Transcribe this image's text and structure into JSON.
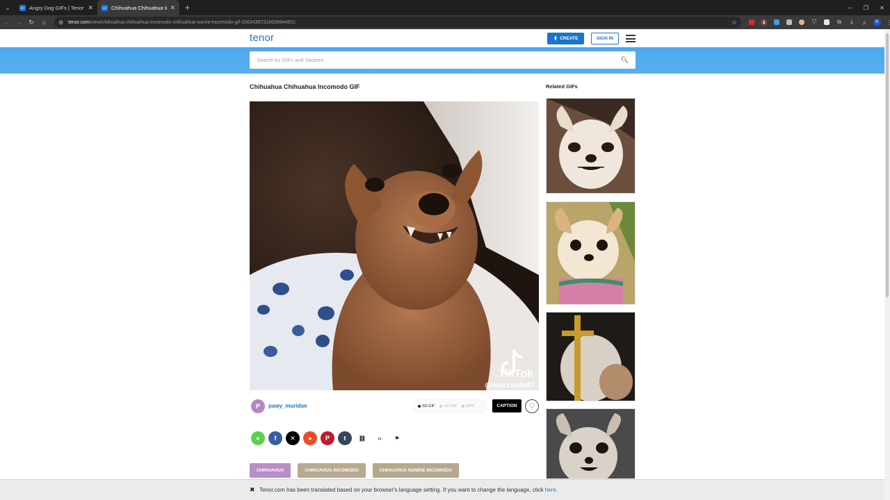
{
  "browser": {
    "tabs": [
      {
        "title": "Angry Dog GIFs | Tenor",
        "active": false
      },
      {
        "title": "Chihuahua Chihuahua Incomo",
        "active": true
      }
    ],
    "new_tab": "+",
    "url_host": "tenor.com",
    "url_path": "/view/chihuahua-chihuahua-incomodo-chihuahua-sonrie-incomodo-gif-15634387316638944501",
    "profile_initial": "N"
  },
  "header": {
    "logo": "tenor",
    "create_label": "CREATE",
    "signin_label": "SIGN IN"
  },
  "search": {
    "placeholder": "Search for GIFs and Stickers"
  },
  "gif": {
    "title": "Chihuahua Chihuahua Incomodo GIF",
    "watermark_brand": "TikTok",
    "watermark_handle": "@marcuslad7",
    "author_initial": "P",
    "author": "pawy_muridae",
    "formats": [
      {
        "label": "SD GIF",
        "selected": true
      },
      {
        "label": "HD GIF",
        "selected": false
      },
      {
        "label": "MP4",
        "selected": false
      }
    ],
    "caption_label": "CAPTION"
  },
  "share": [
    {
      "name": "message",
      "color": "#5ad34b",
      "glyph": "💬"
    },
    {
      "name": "facebook",
      "color": "#3b5ba0",
      "glyph": "f"
    },
    {
      "name": "x",
      "color": "#000000",
      "glyph": "𝕏"
    },
    {
      "name": "reddit",
      "color": "#ef4a24",
      "glyph": "●"
    },
    {
      "name": "pinterest",
      "color": "#bd1c2b",
      "glyph": "P"
    },
    {
      "name": "tumblr",
      "color": "#35465c",
      "glyph": "t"
    },
    {
      "name": "link",
      "color": "",
      "glyph": "🔗"
    },
    {
      "name": "embed",
      "color": "",
      "glyph": "‹›"
    },
    {
      "name": "report",
      "color": "",
      "glyph": "⚑"
    }
  ],
  "tags": [
    {
      "label": "CHIHUAHUA",
      "color": "#b98dc7"
    },
    {
      "label": "CHIHUAHUA INCOMODO",
      "color": "#b9a98e"
    },
    {
      "label": "CHIHUAHUA SONRIE INCOMODO",
      "color": "#b6a88c"
    }
  ],
  "related": {
    "title": "Related GIFs"
  },
  "translate_bar": {
    "message": "Tenor.com has been translated based on your browser's language setting. If you want to change the language, click ",
    "link": "here",
    "suffix": "."
  }
}
